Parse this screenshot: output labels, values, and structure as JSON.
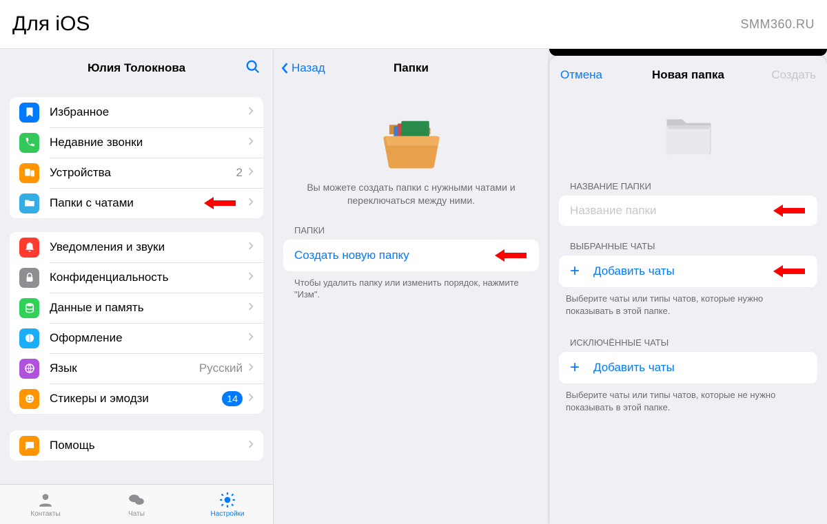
{
  "header": {
    "title": "Для iOS",
    "site": "SMM360.RU"
  },
  "pane1": {
    "username": "Юлия Толокнова",
    "group1": [
      {
        "label": "Избранное"
      },
      {
        "label": "Недавние звонки"
      },
      {
        "label": "Устройства",
        "trail": "2"
      },
      {
        "label": "Папки с чатами"
      }
    ],
    "group2": [
      {
        "label": "Уведомления и звуки"
      },
      {
        "label": "Конфиденциальность"
      },
      {
        "label": "Данные и память"
      },
      {
        "label": "Оформление"
      },
      {
        "label": "Язык",
        "trail": "Русский"
      },
      {
        "label": "Стикеры и эмодзи",
        "badge": "14"
      }
    ],
    "group3": [
      {
        "label": "Помощь"
      }
    ],
    "tabs": {
      "contacts": "Контакты",
      "chats": "Чаты",
      "settings": "Настройки"
    }
  },
  "pane2": {
    "back": "Назад",
    "title": "Папки",
    "desc": "Вы можете создать папки с нужными чатами и переключаться между ними.",
    "sect": "ПАПКИ",
    "create": "Создать новую папку",
    "foot": "Чтобы удалить папку или изменить порядок, нажмите \"Изм\"."
  },
  "pane3": {
    "cancel": "Отмена",
    "title": "Новая папка",
    "create": "Создать",
    "name_sect": "НАЗВАНИЕ ПАПКИ",
    "name_placeholder": "Название папки",
    "sel_sect": "ВЫБРАННЫЕ ЧАТЫ",
    "add": "Добавить чаты",
    "sel_foot": "Выберите чаты или типы чатов, которые нужно показывать в этой папке.",
    "exc_sect": "ИСКЛЮЧЁННЫЕ ЧАТЫ",
    "exc_foot": "Выберите чаты или типы чатов, которые не нужно показывать в этой папке."
  }
}
